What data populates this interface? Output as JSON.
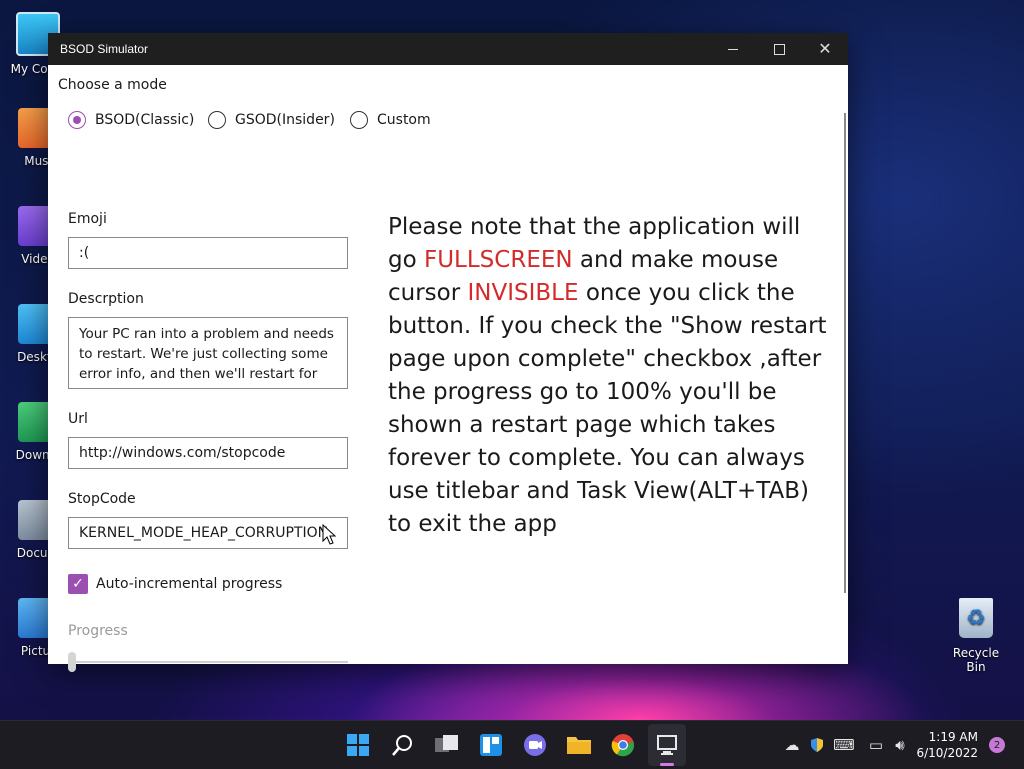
{
  "desktop": {
    "icons": [
      {
        "label": "My Com",
        "icon": "monitor-icon"
      },
      {
        "label": "Musi",
        "icon": "music-folder-icon"
      },
      {
        "label": "Video",
        "icon": "video-folder-icon"
      },
      {
        "label": "Deskto",
        "icon": "desktop-folder-icon"
      },
      {
        "label": "Downlo",
        "icon": "downloads-folder-icon"
      },
      {
        "label": "Docum",
        "icon": "documents-folder-icon"
      },
      {
        "label": "Pictur",
        "icon": "pictures-folder-icon"
      }
    ],
    "recycle_bin": "Recycle Bin"
  },
  "window": {
    "title": "BSOD Simulator",
    "choose_mode": "Choose a mode",
    "modes": [
      {
        "label": "BSOD(Classic)",
        "checked": true
      },
      {
        "label": "GSOD(Insider)",
        "checked": false
      },
      {
        "label": "Custom",
        "checked": false
      }
    ],
    "emoji_label": "Emoji",
    "emoji_value": ":(",
    "description_label": "Descrption",
    "description_value": "Your PC ran into a problem and needs to restart. We're just collecting some error info, and then we'll restart for you",
    "url_label": "Url",
    "url_value": "http://windows.com/stopcode",
    "stopcode_label": "StopCode",
    "stopcode_value": "KERNEL_MODE_HEAP_CORRUPTION",
    "auto_progress_label": "Auto-incremental progress",
    "auto_progress_checked": true,
    "progress_label": "Progress",
    "progress_value": 0,
    "note": {
      "p1": "Please note that the application will go ",
      "red1": "FULLSCREEN",
      "p2": " and make mouse cursor ",
      "red2": "INVISIBLE",
      "p3": " once you click the button. If you check the \"Show restart page upon complete\" checkbox ,after the progress go to 100% you'll be shown a restart page which takes forever to complete. You can always use titlebar and Task View(ALT+TAB) to exit the app"
    },
    "accent_color": "#9b4fb0",
    "warning_color": "#d42a2a"
  },
  "taskbar": {
    "apps": [
      "windows-start-icon",
      "search-icon",
      "task-view-icon",
      "widgets-icon",
      "teams-chat-icon",
      "file-explorer-icon",
      "chrome-icon",
      "bsod-simulator-icon"
    ],
    "time": "1:19 AM",
    "date": "6/10/2022",
    "notifications": "2"
  }
}
